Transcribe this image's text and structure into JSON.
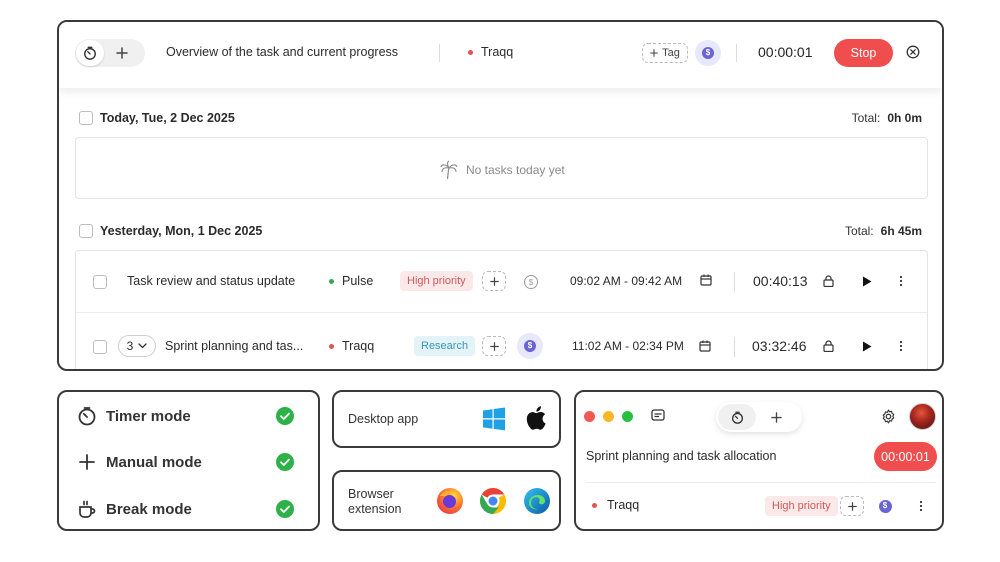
{
  "timer_bar": {
    "description": "Overview of the task and current progress",
    "project": "Traqq",
    "project_color": "#e05353",
    "tag_label": "Tag",
    "elapsed": "00:00:01",
    "stop_label": "Stop",
    "stop_color": "#f04e4e"
  },
  "today": {
    "label": "Today, Tue, 2 Dec 2025",
    "total_label": "Total:",
    "total_value": "0h 0m",
    "empty_text": "No tasks today yet"
  },
  "yesterday": {
    "label": "Yesterday, Mon, 1 Dec 2025",
    "total_label": "Total:",
    "total_value": "6h 45m",
    "tasks": [
      {
        "title": "Task review and status update",
        "project": "Pulse",
        "project_color": "#3aa655",
        "tag": "High priority",
        "time_range": "09:02 AM - 09:42 AM",
        "duration": "00:40:13"
      },
      {
        "group_count": "3",
        "title": "Sprint planning and tas...",
        "project": "Traqq",
        "project_color": "#e05353",
        "tag": "Research",
        "time_range": "11:02 AM - 02:34 PM",
        "duration": "03:32:46"
      }
    ]
  },
  "modes": [
    {
      "label": "Timer mode",
      "icon": "stopwatch-icon"
    },
    {
      "label": "Manual mode",
      "icon": "plus-icon"
    },
    {
      "label": "Break mode",
      "icon": "coffee-icon"
    }
  ],
  "platforms": {
    "desktop_label": "Desktop app",
    "desktop_icons": [
      "windows-icon",
      "apple-icon"
    ],
    "browser_label_line1": "Browser",
    "browser_label_line2": "extension",
    "browser_icons": [
      "firefox-icon",
      "chrome-icon",
      "edge-icon"
    ]
  },
  "mini_app": {
    "task_title": "Sprint planning and task allocation",
    "elapsed": "00:00:01",
    "project": "Traqq",
    "project_color": "#e05353",
    "tag": "High priority"
  },
  "colors": {
    "accent_red": "#f04e4e",
    "check_green": "#2fb14a",
    "tag_high_bg": "#fbe9e9",
    "tag_high_fg": "#d05a5a",
    "tag_research_bg": "#e3f3f8",
    "tag_research_fg": "#3a97b4",
    "billable_purple": "#6b64d6"
  }
}
